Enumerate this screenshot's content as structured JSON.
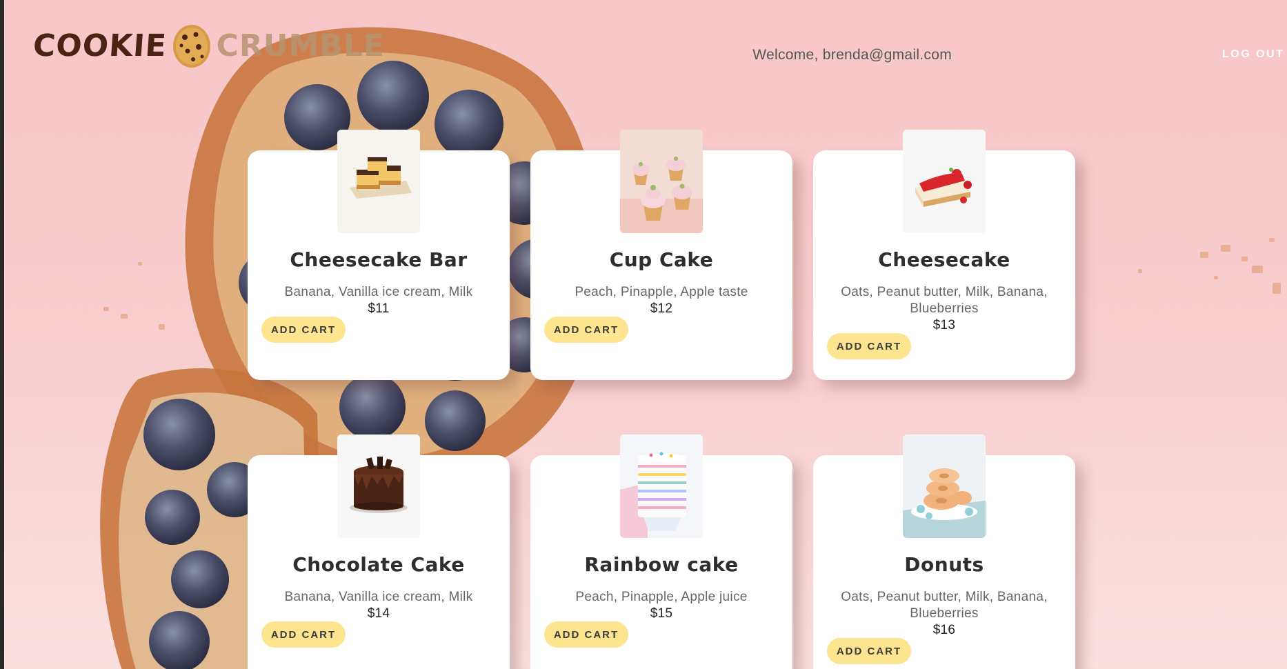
{
  "brand": {
    "word1": "COOKIE",
    "word2": "CRUMBLE",
    "logo_icon": "cookie-icon"
  },
  "header": {
    "welcome_text": "Welcome, brenda@gmail.com",
    "logout_label": "LOG OUT"
  },
  "colors": {
    "background": "#f7c6c8",
    "button": "#fde58f",
    "card": "#ffffff",
    "brand_dark": "#4a2412",
    "brand_light": "#b59570"
  },
  "products": [
    {
      "name": "Cheesecake Bar",
      "description": "Banana, Vanilla ice cream, Milk",
      "price": "$11",
      "button_label": "ADD CART",
      "image_icon": "cheesecake-bar-image"
    },
    {
      "name": "Cup Cake",
      "description": "Peach, Pinapple, Apple taste",
      "price": "$12",
      "button_label": "ADD CART",
      "image_icon": "cupcake-image"
    },
    {
      "name": "Cheesecake",
      "description": "Oats, Peanut butter, Milk, Banana, Blueberries",
      "price": "$13",
      "button_label": "ADD CART",
      "image_icon": "cheesecake-image"
    },
    {
      "name": "Chocolate Cake",
      "description": "Banana, Vanilla ice cream, Milk",
      "price": "$14",
      "button_label": "ADD CART",
      "image_icon": "chocolate-cake-image"
    },
    {
      "name": "Rainbow cake",
      "description": "Peach, Pinapple, Apple juice",
      "price": "$15",
      "button_label": "ADD CART",
      "image_icon": "rainbow-cake-image"
    },
    {
      "name": "Donuts",
      "description": "Oats, Peanut butter, Milk, Banana, Blueberries",
      "price": "$16",
      "button_label": "ADD CART",
      "image_icon": "donuts-image"
    }
  ]
}
